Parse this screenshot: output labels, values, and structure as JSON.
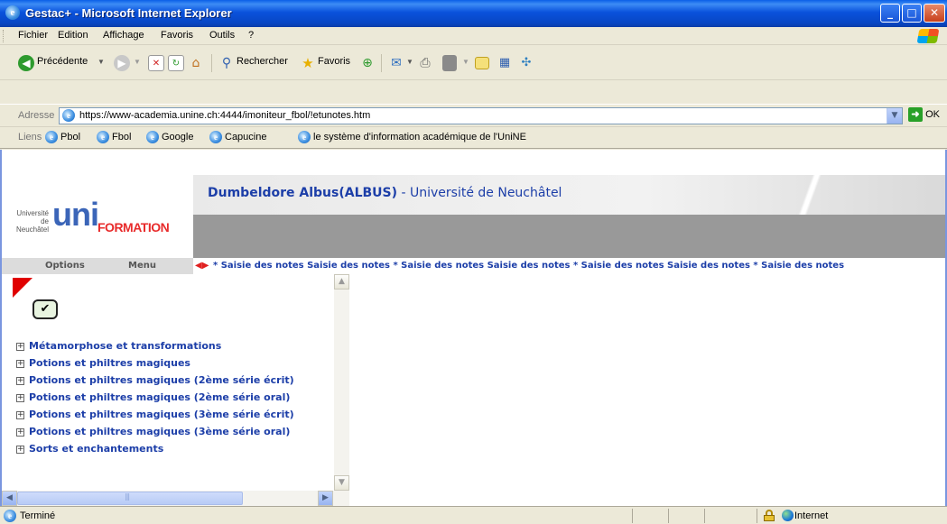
{
  "window": {
    "title": "Gestac+ - Microsoft Internet Explorer"
  },
  "menu": [
    "Fichier",
    "Edition",
    "Affichage",
    "Favoris",
    "Outils",
    "?"
  ],
  "toolbar": {
    "back": "Précédente",
    "search": "Rechercher",
    "favorites": "Favoris"
  },
  "address": {
    "label": "Adresse",
    "url": "https://www-academia.unine.ch:4444/imoniteur_fbol/!etunotes.htm",
    "go": "OK"
  },
  "links": {
    "label": "Liens",
    "items": [
      "Pbol",
      "Fbol",
      "Google",
      "Capucine",
      "le système d'information académique de l'UniNE"
    ]
  },
  "page": {
    "user": "Dumbeldore Albus(ALBUS)",
    "university": " - Université de Neuchâtel",
    "logo": {
      "univ_line1": "Université",
      "univ_line2": "de Neuchâtel",
      "unine": "uni",
      "formation": "FORMATION"
    },
    "nav": {
      "options": "Options",
      "menu": "Menu"
    },
    "marquee": "* Saisie des notes Saisie des notes * Saisie des notes Saisie des notes * Saisie des notes Saisie des notes * Saisie des notes",
    "tree": [
      "Métamorphose et transformations",
      "Potions et philtres magiques",
      "Potions et philtres magiques (2ème série écrit)",
      "Potions et philtres magiques (2ème série oral)",
      "Potions et philtres magiques (3ème série écrit)",
      "Potions et philtres magiques (3ème série oral)",
      "Sorts et enchantements"
    ]
  },
  "status": {
    "text": "Terminé",
    "zone": "Internet"
  },
  "colors": {
    "title_blue": "#0a52dc",
    "link_blue": "#1c3ea8",
    "banner_gray": "#999999",
    "logo_red": "#e82b2b"
  }
}
